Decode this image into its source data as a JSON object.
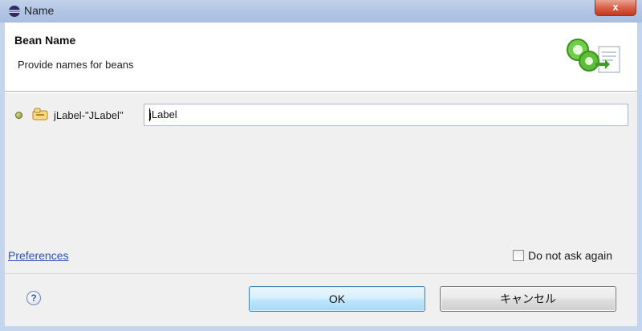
{
  "window": {
    "title": "Name",
    "close_label": "x"
  },
  "header": {
    "title": "Bean Name",
    "description": "Provide names for beans",
    "icon": "wizard-beans-icon"
  },
  "bean": {
    "label": "jLabel-\"JLabel\"",
    "name_value": "jLabel",
    "status_icon": "bullet-icon",
    "type_icon": "bean-icon"
  },
  "footer": {
    "preferences_link": "Preferences",
    "dont_ask_label": "Do not ask again",
    "dont_ask_checked": false,
    "help_label": "?",
    "ok_label": "OK",
    "cancel_label": "キャンセル"
  },
  "colors": {
    "link": "#2b4fb8",
    "ok_border": "#3c7fb1",
    "title_bar": "#b3c6e6"
  }
}
